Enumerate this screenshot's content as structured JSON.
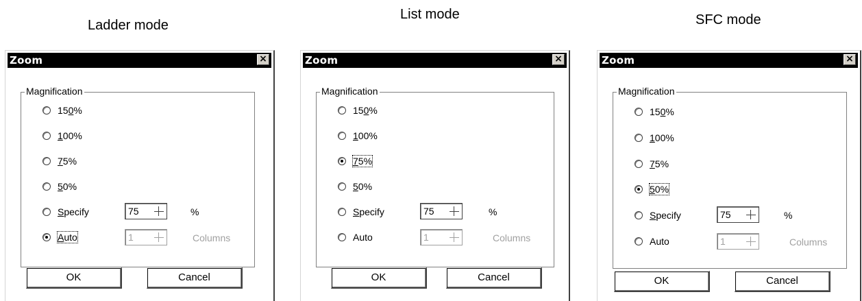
{
  "captions": [
    "Ladder mode",
    "List mode",
    "SFC mode"
  ],
  "dialogs": [
    {
      "title": "Zoom",
      "close_glyph": "×",
      "group_label": "Magnification",
      "options": [
        {
          "pre": "15",
          "u": "0",
          "post": "%"
        },
        {
          "pre": "",
          "u": "1",
          "post": "00%"
        },
        {
          "pre": "",
          "u": "7",
          "post": "5%"
        },
        {
          "pre": "",
          "u": "5",
          "post": "0%"
        },
        {
          "pre": "",
          "u": "S",
          "post": "pecify"
        },
        {
          "pre": "",
          "u": "A",
          "post": "uto"
        }
      ],
      "selected": "Auto",
      "specify_value": "75",
      "specify_unit": "%",
      "auto_value": "1",
      "auto_unit": "Columns",
      "ok_label": "OK",
      "cancel_label": "Cancel"
    },
    {
      "title": "Zoom",
      "close_glyph": "×",
      "group_label": "Magnification",
      "options": [
        {
          "pre": "15",
          "u": "0",
          "post": "%"
        },
        {
          "pre": "",
          "u": "1",
          "post": "00%"
        },
        {
          "pre": "",
          "u": "7",
          "post": "5%"
        },
        {
          "pre": "",
          "u": "5",
          "post": "0%"
        },
        {
          "pre": "",
          "u": "S",
          "post": "pecify"
        },
        {
          "pre": "",
          "u": "",
          "post": "Auto"
        }
      ],
      "selected": "75%",
      "specify_value": "75",
      "specify_unit": "%",
      "auto_value": "1",
      "auto_unit": "Columns",
      "ok_label": "OK",
      "cancel_label": "Cancel"
    },
    {
      "title": "Zoom",
      "close_glyph": "×",
      "group_label": "Magnification",
      "options": [
        {
          "pre": "15",
          "u": "0",
          "post": "%"
        },
        {
          "pre": "",
          "u": "1",
          "post": "00%"
        },
        {
          "pre": "",
          "u": "7",
          "post": "5%"
        },
        {
          "pre": "",
          "u": "5",
          "post": "0%"
        },
        {
          "pre": "",
          "u": "S",
          "post": "pecify"
        },
        {
          "pre": "",
          "u": "",
          "post": "Auto"
        }
      ],
      "selected": "50%",
      "specify_value": "75",
      "specify_unit": "%",
      "auto_value": "1",
      "auto_unit": "Columns",
      "ok_label": "OK",
      "cancel_label": "Cancel"
    }
  ]
}
